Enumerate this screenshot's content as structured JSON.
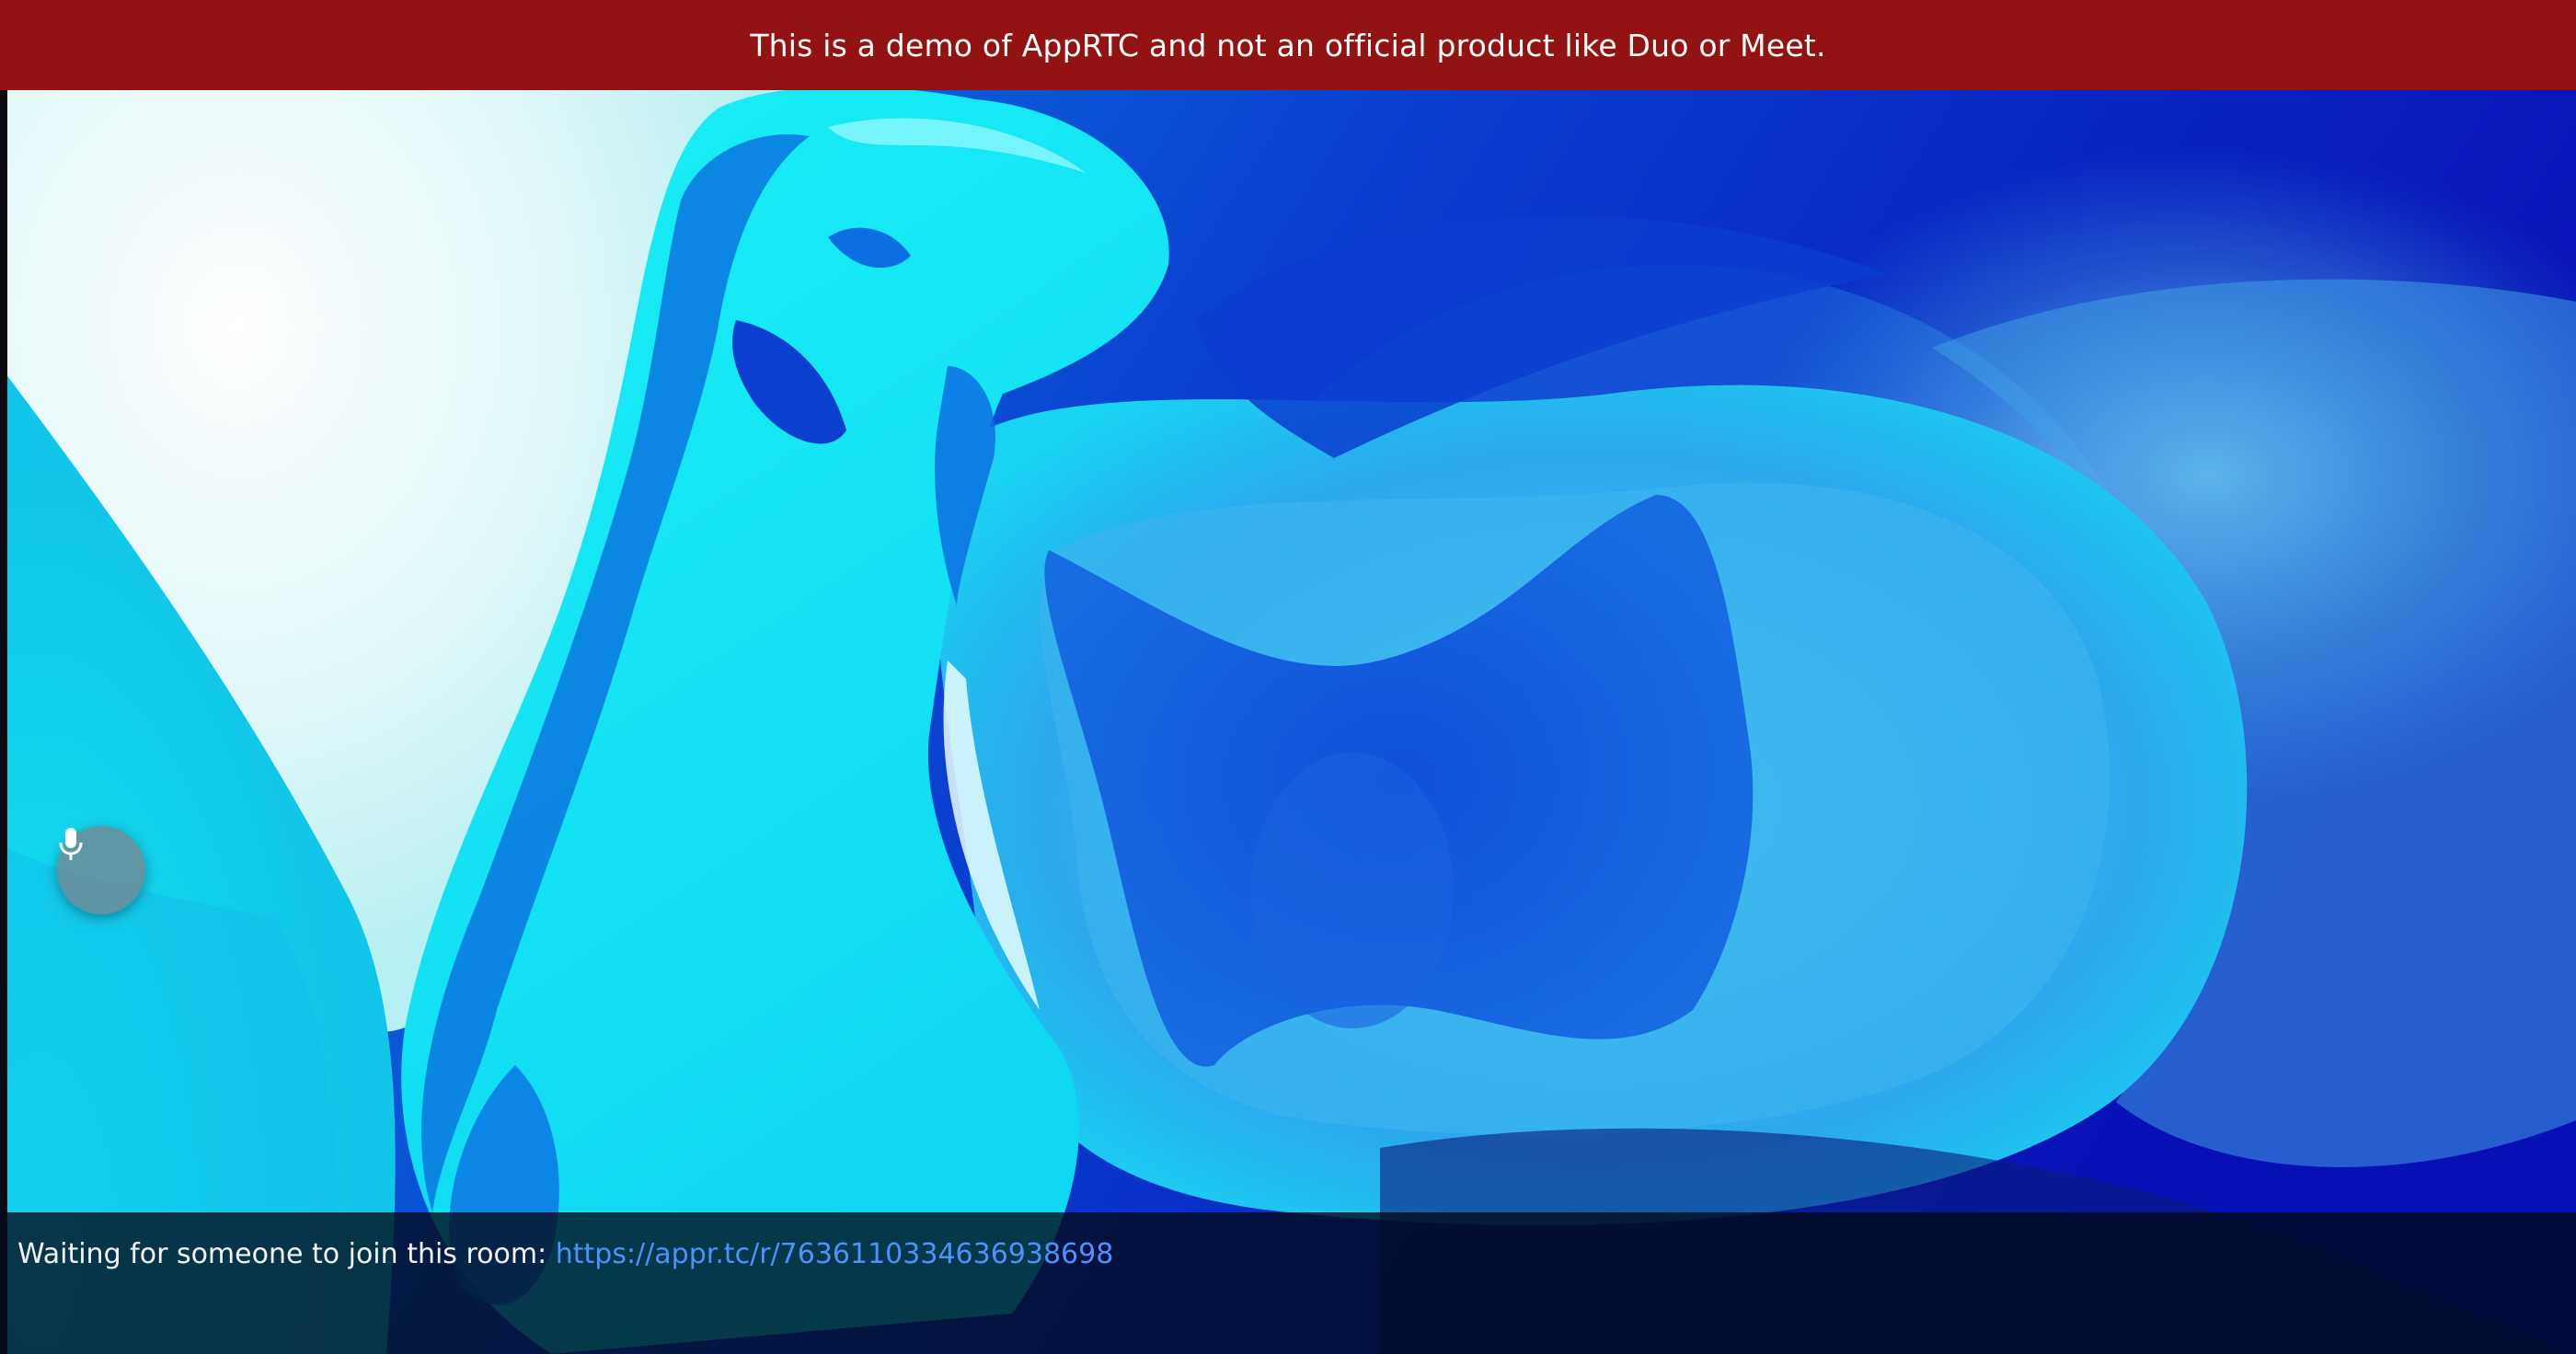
{
  "banner": {
    "text": "This is a demo of AppRTC and not an official product like Duo or Meet.",
    "background_color": "#931212"
  },
  "video": {
    "description_icon": "remote-video-feed"
  },
  "controls": {
    "mic_icon": "microphone-icon"
  },
  "info": {
    "waiting_text": "Waiting for someone to join this room:",
    "room_link": "https://appr.tc/r/7636110334636938698",
    "link_color": "#4d90fe"
  }
}
